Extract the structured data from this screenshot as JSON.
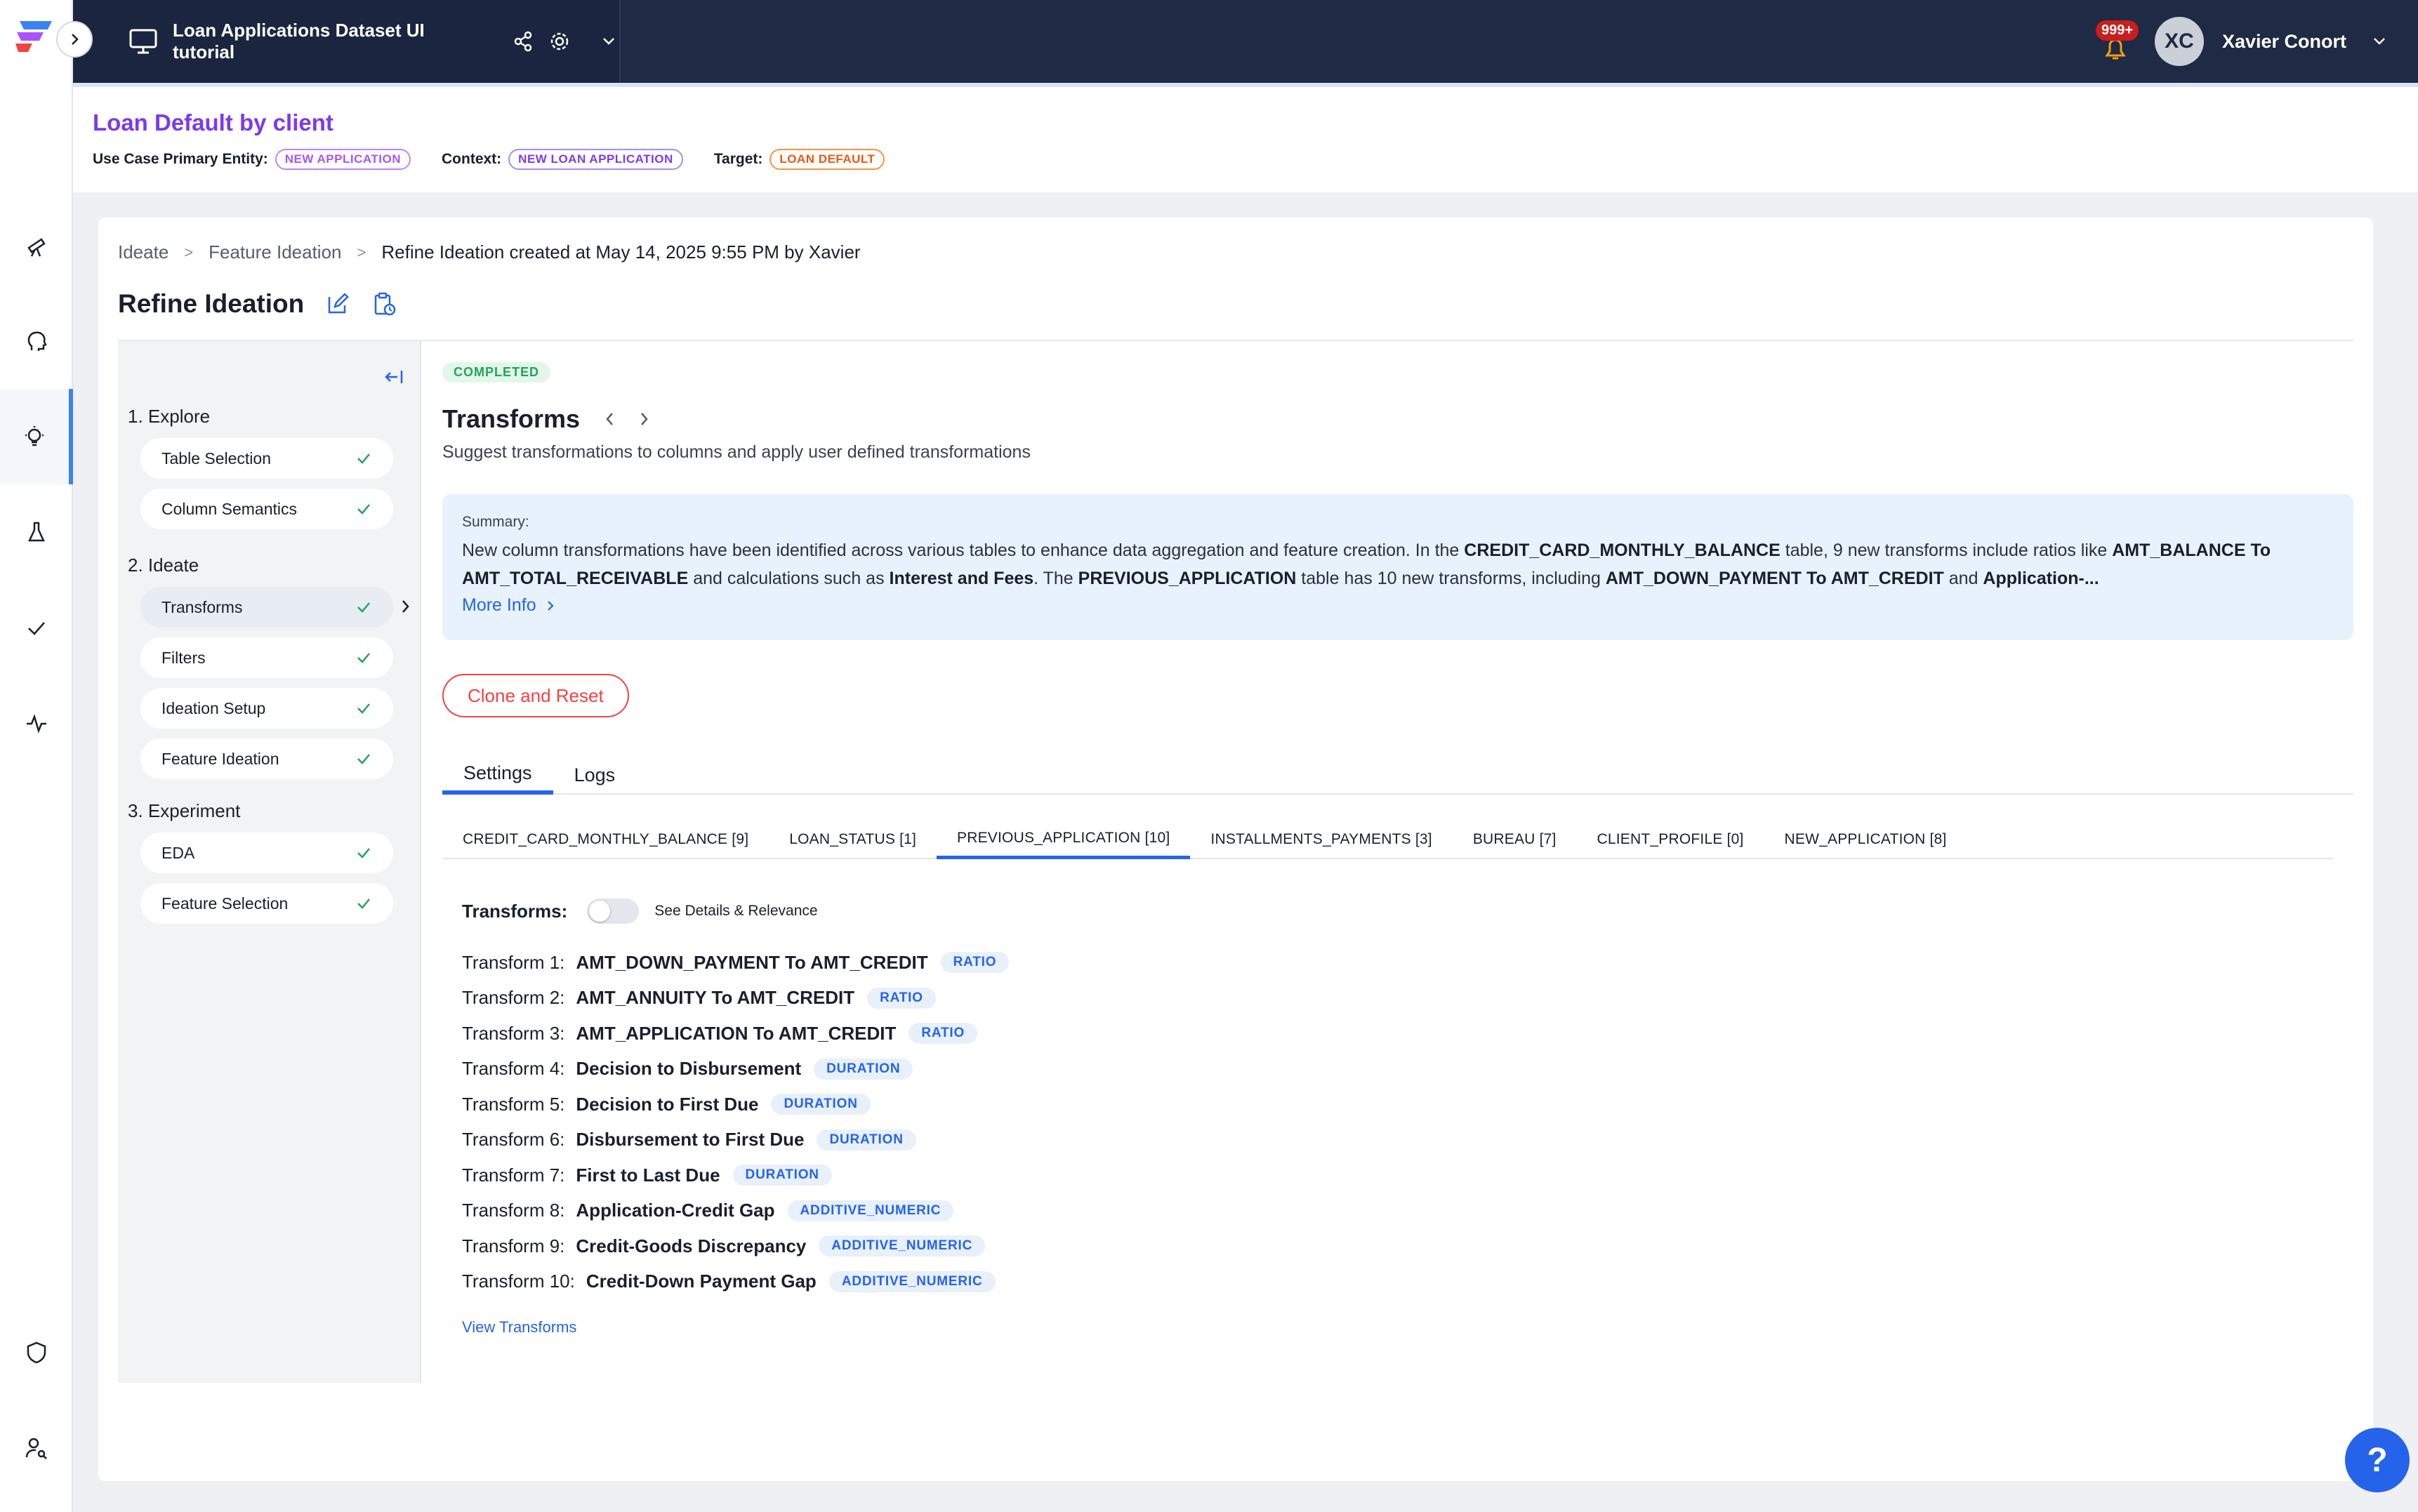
{
  "topbar": {
    "project_title": "Loan Applications Dataset UI tutorial",
    "notification_count": "999+",
    "user_initials": "XC",
    "user_name": "Xavier Conort"
  },
  "usecase": {
    "title": "Loan Default by client",
    "primary_entity_label": "Use Case Primary Entity:",
    "primary_entity": "NEW APPLICATION",
    "context_label": "Context:",
    "context": "NEW LOAN APPLICATION",
    "target_label": "Target:",
    "target": "LOAN DEFAULT"
  },
  "breadcrumb": {
    "items": [
      "Ideate",
      "Feature Ideation",
      "Refine Ideation created at May 14, 2025 9:55 PM by Xavier"
    ],
    "separator": ">"
  },
  "page_title": "Refine Ideation",
  "steps": {
    "groups": [
      {
        "label": "1. Explore",
        "items": [
          "Table Selection",
          "Column Semantics"
        ]
      },
      {
        "label": "2. Ideate",
        "items": [
          "Transforms",
          "Filters",
          "Ideation Setup",
          "Feature Ideation"
        ]
      },
      {
        "label": "3. Experiment",
        "items": [
          "EDA",
          "Feature Selection"
        ]
      }
    ]
  },
  "status": "COMPLETED",
  "transforms": {
    "title": "Transforms",
    "description": "Suggest transformations to columns and apply user defined transformations"
  },
  "summary": {
    "label": "Summary:",
    "parts": [
      "New column transformations have been identified across various tables to enhance data aggregation and feature creation. In the ",
      "CREDIT_CARD_MONTHLY_BALANCE",
      " table, 9 new transforms include ratios like ",
      "AMT_BALANCE To AMT_TOTAL_RECEIVABLE",
      " and calculations such as ",
      "Interest and Fees",
      ". The ",
      "PREVIOUS_APPLICATION",
      " table has 10 new transforms, including ",
      "AMT_DOWN_PAYMENT To AMT_CREDIT",
      " and ",
      "Application-..."
    ],
    "more_label": "More Info"
  },
  "clone_label": "Clone and Reset",
  "tabs": [
    "Settings",
    "Logs"
  ],
  "tables": [
    "CREDIT_CARD_MONTHLY_BALANCE [9]",
    "LOAN_STATUS [1]",
    "PREVIOUS_APPLICATION [10]",
    "INSTALLMENTS_PAYMENTS [3]",
    "BUREAU [7]",
    "CLIENT_PROFILE [0]",
    "NEW_APPLICATION [8]"
  ],
  "transforms_header": "Transforms:",
  "toggle_label": "See Details & Relevance",
  "transform_list": [
    {
      "num": "Transform 1:",
      "name": "AMT_DOWN_PAYMENT To AMT_CREDIT",
      "tag": "RATIO"
    },
    {
      "num": "Transform 2:",
      "name": "AMT_ANNUITY To AMT_CREDIT",
      "tag": "RATIO"
    },
    {
      "num": "Transform 3:",
      "name": "AMT_APPLICATION To AMT_CREDIT",
      "tag": "RATIO"
    },
    {
      "num": "Transform 4:",
      "name": "Decision to Disbursement",
      "tag": "DURATION"
    },
    {
      "num": "Transform 5:",
      "name": "Decision to First Due",
      "tag": "DURATION"
    },
    {
      "num": "Transform 6:",
      "name": "Disbursement to First Due",
      "tag": "DURATION"
    },
    {
      "num": "Transform 7:",
      "name": "First to Last Due",
      "tag": "DURATION"
    },
    {
      "num": "Transform 8:",
      "name": "Application-Credit Gap",
      "tag": "ADDITIVE_NUMERIC"
    },
    {
      "num": "Transform 9:",
      "name": "Credit-Goods Discrepancy",
      "tag": "ADDITIVE_NUMERIC"
    },
    {
      "num": "Transform 10:",
      "name": "Credit-Down Payment Gap",
      "tag": "ADDITIVE_NUMERIC"
    }
  ],
  "view_transforms_label": "View Transforms",
  "help_label": "?",
  "colors": {
    "accent": "#2563eb",
    "topbar": "#1f2a44",
    "title_purple": "#7c3aed",
    "success": "#22a55a",
    "danger": "#ef4444"
  }
}
